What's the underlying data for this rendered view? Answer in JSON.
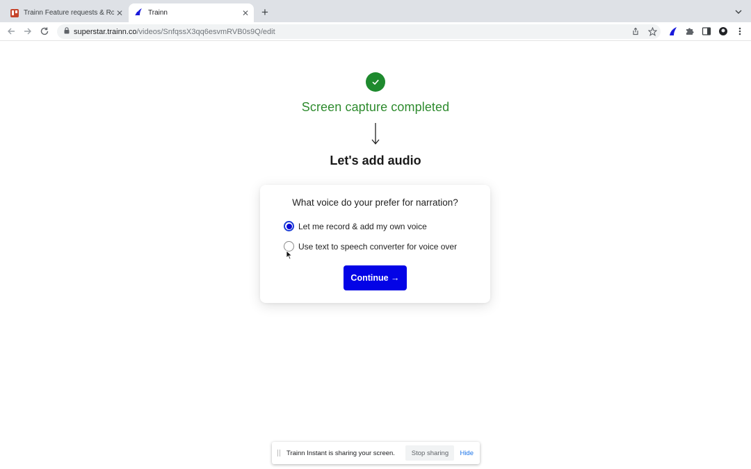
{
  "browser": {
    "tabs": [
      {
        "title": "Trainn Feature requests & Roa",
        "icon": "trello-icon",
        "active": false
      },
      {
        "title": "Trainn",
        "icon": "trainn-logo-icon",
        "active": true
      }
    ],
    "url_host": "superstar.trainn.co",
    "url_path": "/videos/SnfqssX3qq6esvmRVB0s9Q/edit"
  },
  "page": {
    "status_title": "Screen capture completed",
    "step_title": "Let's add audio",
    "colors": {
      "success": "#2e8b2e",
      "accent": "#0404e6"
    }
  },
  "card": {
    "question": "What voice do your prefer for narration?",
    "options": [
      {
        "label": "Let me record & add my own voice",
        "checked": true
      },
      {
        "label": "Use text to speech converter for voice over",
        "checked": false
      }
    ],
    "continue_label": "Continue →"
  },
  "sharebar": {
    "message": "Trainn Instant is sharing your screen.",
    "stop_label": "Stop sharing",
    "hide_label": "Hide"
  }
}
